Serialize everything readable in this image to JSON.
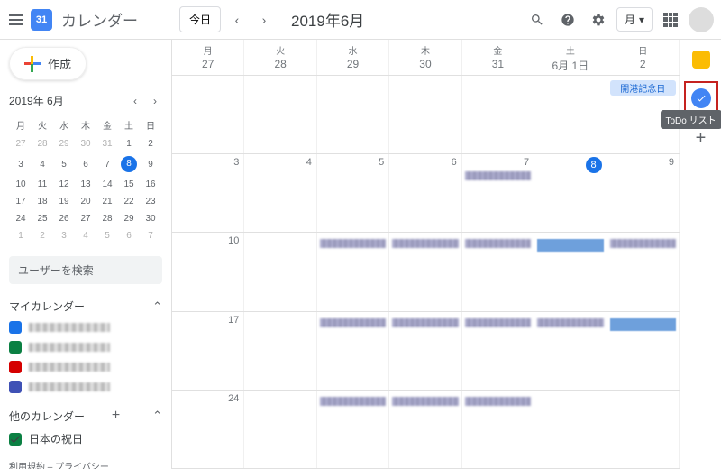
{
  "header": {
    "app_title": "カレンダー",
    "logo_text": "31",
    "today_btn": "今日",
    "month_title": "2019年6月",
    "view_label": "月"
  },
  "sidebar": {
    "create_label": "作成",
    "mini_month": "2019年 6月",
    "dow": [
      "月",
      "火",
      "水",
      "木",
      "金",
      "土",
      "日"
    ],
    "search_placeholder": "ユーザーを検索",
    "my_calendars_label": "マイカレンダー",
    "other_calendars_label": "他のカレンダー",
    "holiday_label": "日本の祝日",
    "footer": "利用規約 – プライバシー"
  },
  "mini_cal": [
    [
      {
        "n": "27",
        "om": true
      },
      {
        "n": "28",
        "om": true
      },
      {
        "n": "29",
        "om": true
      },
      {
        "n": "30",
        "om": true
      },
      {
        "n": "31",
        "om": true
      },
      {
        "n": "1"
      },
      {
        "n": "2"
      }
    ],
    [
      {
        "n": "3"
      },
      {
        "n": "4"
      },
      {
        "n": "5"
      },
      {
        "n": "6"
      },
      {
        "n": "7"
      },
      {
        "n": "8",
        "today": true
      },
      {
        "n": "9"
      }
    ],
    [
      {
        "n": "10"
      },
      {
        "n": "11"
      },
      {
        "n": "12"
      },
      {
        "n": "13"
      },
      {
        "n": "14"
      },
      {
        "n": "15"
      },
      {
        "n": "16"
      }
    ],
    [
      {
        "n": "17"
      },
      {
        "n": "18"
      },
      {
        "n": "19"
      },
      {
        "n": "20"
      },
      {
        "n": "21"
      },
      {
        "n": "22"
      },
      {
        "n": "23"
      }
    ],
    [
      {
        "n": "24"
      },
      {
        "n": "25"
      },
      {
        "n": "26"
      },
      {
        "n": "27"
      },
      {
        "n": "28"
      },
      {
        "n": "29"
      },
      {
        "n": "30"
      }
    ],
    [
      {
        "n": "1",
        "om": true
      },
      {
        "n": "2",
        "om": true
      },
      {
        "n": "3",
        "om": true
      },
      {
        "n": "4",
        "om": true
      },
      {
        "n": "5",
        "om": true
      },
      {
        "n": "6",
        "om": true
      },
      {
        "n": "7",
        "om": true
      }
    ]
  ],
  "my_calendars": [
    {
      "color": "#1a73e8"
    },
    {
      "color": "#0b8043"
    },
    {
      "color": "#d50000"
    },
    {
      "color": "#3f51b5"
    }
  ],
  "grid": {
    "dow": [
      "月",
      "火",
      "水",
      "木",
      "金",
      "土",
      "日"
    ],
    "first_row_nums": [
      "27",
      "28",
      "29",
      "30",
      "31",
      "6月 1日",
      "2"
    ],
    "event_holiday": "開港記念日",
    "weeks": [
      [
        {
          "n": "3"
        },
        {
          "n": "4"
        },
        {
          "n": "5"
        },
        {
          "n": "6"
        },
        {
          "n": "7",
          "blur": true
        },
        {
          "n": "8",
          "today": true
        },
        {
          "n": "9"
        }
      ],
      [
        {
          "n": "10"
        },
        {
          "n": ""
        },
        {
          "n": "",
          "blur": true
        },
        {
          "n": "",
          "blur": true
        },
        {
          "n": "",
          "blur": true
        },
        {
          "n": "",
          "bluebar": true
        },
        {
          "n": "",
          "blur": true
        }
      ],
      [
        {
          "n": "17"
        },
        {
          "n": ""
        },
        {
          "n": "",
          "blur": true
        },
        {
          "n": "",
          "blur": true
        },
        {
          "n": "",
          "blur": true
        },
        {
          "n": "",
          "blur": true
        },
        {
          "n": "",
          "bluebar": true
        }
      ],
      [
        {
          "n": "24"
        },
        {
          "n": ""
        },
        {
          "n": "",
          "blur": true
        },
        {
          "n": "",
          "blur": true
        },
        {
          "n": "",
          "blur": true
        },
        {
          "n": ""
        },
        {
          "n": ""
        }
      ]
    ]
  },
  "side_panel": {
    "tasks_tooltip": "ToDo リスト"
  }
}
